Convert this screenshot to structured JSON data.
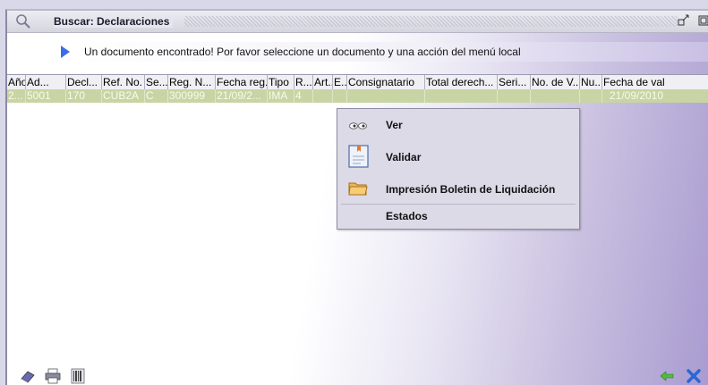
{
  "window": {
    "title": "Buscar: Declaraciones",
    "icons": [
      "search-icon",
      "minimize-icon",
      "maximize-icon"
    ]
  },
  "message": "Un documento encontrado! Por favor seleccione un documento y una acción del menú local",
  "table": {
    "headers": [
      "Año",
      "Ad...",
      "Decl...",
      "Ref. No.",
      "Se...",
      "Reg. N...",
      "Fecha reg.",
      "Tipo",
      "R...",
      "Art...",
      "E...",
      "Consignatario",
      "Total derech...",
      "Seri...",
      "No. de V...",
      "Nu...",
      "Fecha de val"
    ],
    "row": [
      "2...",
      "5001",
      "170",
      "CUB2A",
      "C",
      "300999",
      "21/09/2...",
      "IMA",
      "4",
      "",
      "",
      "",
      "",
      "",
      "",
      "",
      "21/09/2010"
    ],
    "selected_row_color": "#c8d4a4"
  },
  "context_menu": {
    "items": [
      {
        "label": "Ver",
        "icon": "eyes-icon"
      },
      {
        "label": "Validar",
        "icon": "document-check-icon"
      },
      {
        "label": "Impresión Boletin de Liquidación",
        "icon": "folder-icon"
      },
      {
        "label": "Estados",
        "icon": ""
      }
    ]
  },
  "bottom_bar": {
    "icons": [
      "book-icon",
      "printer-icon",
      "barcode-icon",
      "back-arrow-icon",
      "close-x-icon"
    ]
  },
  "colors": {
    "accent": "#3a6ee8",
    "row_highlight": "#c8d4a4",
    "menu_bg": "#dcdae6"
  }
}
